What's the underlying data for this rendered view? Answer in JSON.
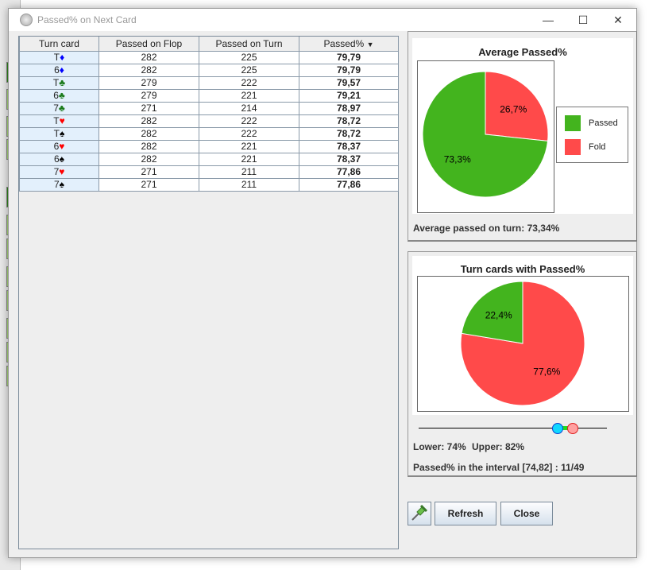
{
  "window": {
    "title": "Passed% on Next Card",
    "minimize": "—",
    "maximize": "☐",
    "close": "✕"
  },
  "table": {
    "columns": [
      "Turn card",
      "Passed on Flop",
      "Passed on Turn",
      "Passed%"
    ],
    "sort_indicator": "▼",
    "rows": [
      {
        "rank": "T",
        "suit": "♦",
        "suit_color": "#0000ff",
        "flop": "282",
        "turn": "225",
        "pct": "79,79"
      },
      {
        "rank": "6",
        "suit": "♦",
        "suit_color": "#0000ff",
        "flop": "282",
        "turn": "225",
        "pct": "79,79"
      },
      {
        "rank": "T",
        "suit": "♣",
        "suit_color": "#1a7a1a",
        "flop": "279",
        "turn": "222",
        "pct": "79,57"
      },
      {
        "rank": "6",
        "suit": "♣",
        "suit_color": "#1a7a1a",
        "flop": "279",
        "turn": "221",
        "pct": "79,21"
      },
      {
        "rank": "7",
        "suit": "♣",
        "suit_color": "#1a7a1a",
        "flop": "271",
        "turn": "214",
        "pct": "78,97"
      },
      {
        "rank": "T",
        "suit": "♥",
        "suit_color": "#ff0000",
        "flop": "282",
        "turn": "222",
        "pct": "78,72"
      },
      {
        "rank": "T",
        "suit": "♠",
        "suit_color": "#000000",
        "flop": "282",
        "turn": "222",
        "pct": "78,72"
      },
      {
        "rank": "6",
        "suit": "♥",
        "suit_color": "#ff0000",
        "flop": "282",
        "turn": "221",
        "pct": "78,37"
      },
      {
        "rank": "6",
        "suit": "♠",
        "suit_color": "#000000",
        "flop": "282",
        "turn": "221",
        "pct": "78,37"
      },
      {
        "rank": "7",
        "suit": "♥",
        "suit_color": "#ff0000",
        "flop": "271",
        "turn": "211",
        "pct": "77,86"
      },
      {
        "rank": "7",
        "suit": "♠",
        "suit_color": "#000000",
        "flop": "271",
        "turn": "211",
        "pct": "77,86"
      }
    ]
  },
  "chart1": {
    "title": "Average Passed%",
    "slices": [
      {
        "name": "Passed",
        "value": 73.3,
        "label": "73,3%",
        "color": "#43b41e"
      },
      {
        "name": "Fold",
        "value": 26.7,
        "label": "26,7%",
        "color": "#ff4a4a"
      }
    ],
    "legend": [
      "Passed",
      "Fold"
    ],
    "summary": "Average passed on turn: 73,34%"
  },
  "chart2": {
    "title": "Turn cards with Passed%",
    "slices": [
      {
        "value": 22.4,
        "label": "22,4%",
        "color": "#43b41e"
      },
      {
        "value": 77.6,
        "label": "77,6%",
        "color": "#ff4a4a"
      }
    ]
  },
  "slider": {
    "lower": 74,
    "upper": 82,
    "lower_label": "Lower: 74%",
    "upper_label": "Upper: 82%",
    "interval_text": "Passed% in the interval [74,82] : 11/49"
  },
  "buttons": {
    "pin": "pin-icon",
    "refresh": "Refresh",
    "close": "Close"
  }
}
